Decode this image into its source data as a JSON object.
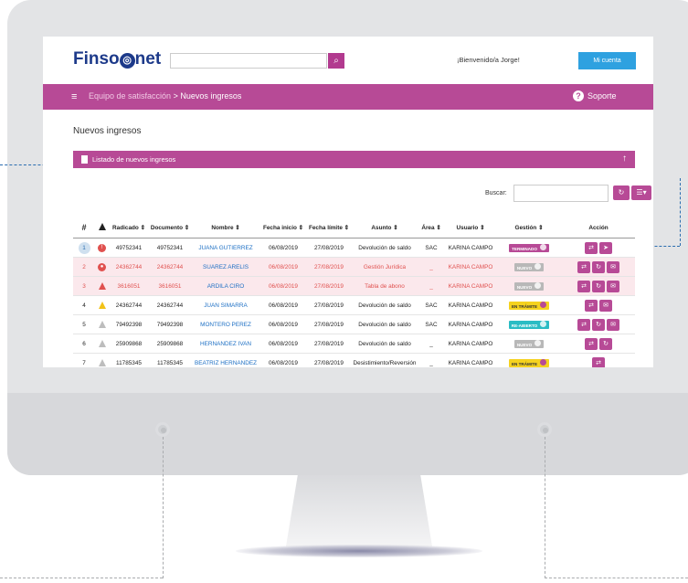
{
  "app": {
    "brand_pre": "Finso",
    "brand_mid": "◎",
    "brand_post": "net",
    "search_icon": "search-icon",
    "welcome": "¡Bienvenido/a Jorge!",
    "account_button": "Mi cuenta",
    "accent_color": "#b74a96",
    "button_color": "#2ea1e0"
  },
  "navbar": {
    "menu_icon": "≡",
    "breadcrumb_root": "Equipo de satisfacción",
    "breadcrumb_sep": ">",
    "breadcrumb_current": "Nuevos ingresos",
    "help_icon": "?",
    "help_label": "Soporte"
  },
  "page": {
    "title": "Nuevos ingresos",
    "panel_title": "Listado de nuevos ingresos",
    "panel_toggle": "↑",
    "search_label": "Buscar:",
    "refresh_icon": "↻",
    "columns_icon": "☰▾"
  },
  "table": {
    "headers": [
      "#",
      "",
      "Radicado ⇕",
      "Documento ⇕",
      "Nombre ⇕",
      "Fecha inicio ⇕",
      "Fecha límite ⇕",
      "Asunto ⇕",
      "Área ⇕",
      "Usuario ⇕",
      "Gestión ⇕",
      "Acción"
    ],
    "rows": [
      {
        "n": "1",
        "radicado": "49752341",
        "documento": "49752341",
        "nombre": "JUANA GUTIERREZ",
        "inicio": "06/08/2019",
        "limite": "27/08/2019",
        "asunto": "Devolución de saldo",
        "area": "SAC",
        "usuario": "KARINA CAMPO",
        "gestion": "TERMINADO"
      },
      {
        "n": "2",
        "radicado": "24362744",
        "documento": "24362744",
        "nombre": "SUAREZ ARELIS",
        "inicio": "06/08/2019",
        "limite": "27/08/2019",
        "asunto": "Gestión Jurídica",
        "area": "_",
        "usuario": "KARINA CAMPO",
        "gestion": "NUEVO"
      },
      {
        "n": "3",
        "radicado": "3616051",
        "documento": "3616051",
        "nombre": "ARDILA CIRO",
        "inicio": "06/08/2019",
        "limite": "27/08/2019",
        "asunto": "Tabla de abono",
        "area": "_",
        "usuario": "KARINA CAMPO",
        "gestion": "NUEVO"
      },
      {
        "n": "4",
        "radicado": "24362744",
        "documento": "24362744",
        "nombre": "JUAN SIMARRA",
        "inicio": "06/08/2019",
        "limite": "27/08/2019",
        "asunto": "Devolución de saldo",
        "area": "SAC",
        "usuario": "KARINA CAMPO",
        "gestion": "EN TRÁMITE"
      },
      {
        "n": "5",
        "radicado": "79492398",
        "documento": "79492398",
        "nombre": "MONTERO PEREZ",
        "inicio": "06/08/2019",
        "limite": "27/08/2019",
        "asunto": "Devolución de saldo",
        "area": "SAC",
        "usuario": "KARINA CAMPO",
        "gestion": "RE-ABIERTO"
      },
      {
        "n": "6",
        "radicado": "25909868",
        "documento": "25909868",
        "nombre": "HERNANDEZ IVAN",
        "inicio": "06/08/2019",
        "limite": "27/08/2019",
        "asunto": "Devolución de saldo",
        "area": "_",
        "usuario": "KARINA CAMPO",
        "gestion": "NUEVO"
      },
      {
        "n": "7",
        "radicado": "11785345",
        "documento": "11785345",
        "nombre": "BEATRIZ HERNANDEZ",
        "inicio": "06/08/2019",
        "limite": "27/08/2019",
        "asunto": "Desistimiento/Reversión",
        "area": "_",
        "usuario": "KARINA CAMPO",
        "gestion": "EN TRÁMITE"
      }
    ]
  },
  "icons": {
    "assign": "⇄",
    "send": "➤",
    "reload": "↻",
    "mail": "✉"
  }
}
